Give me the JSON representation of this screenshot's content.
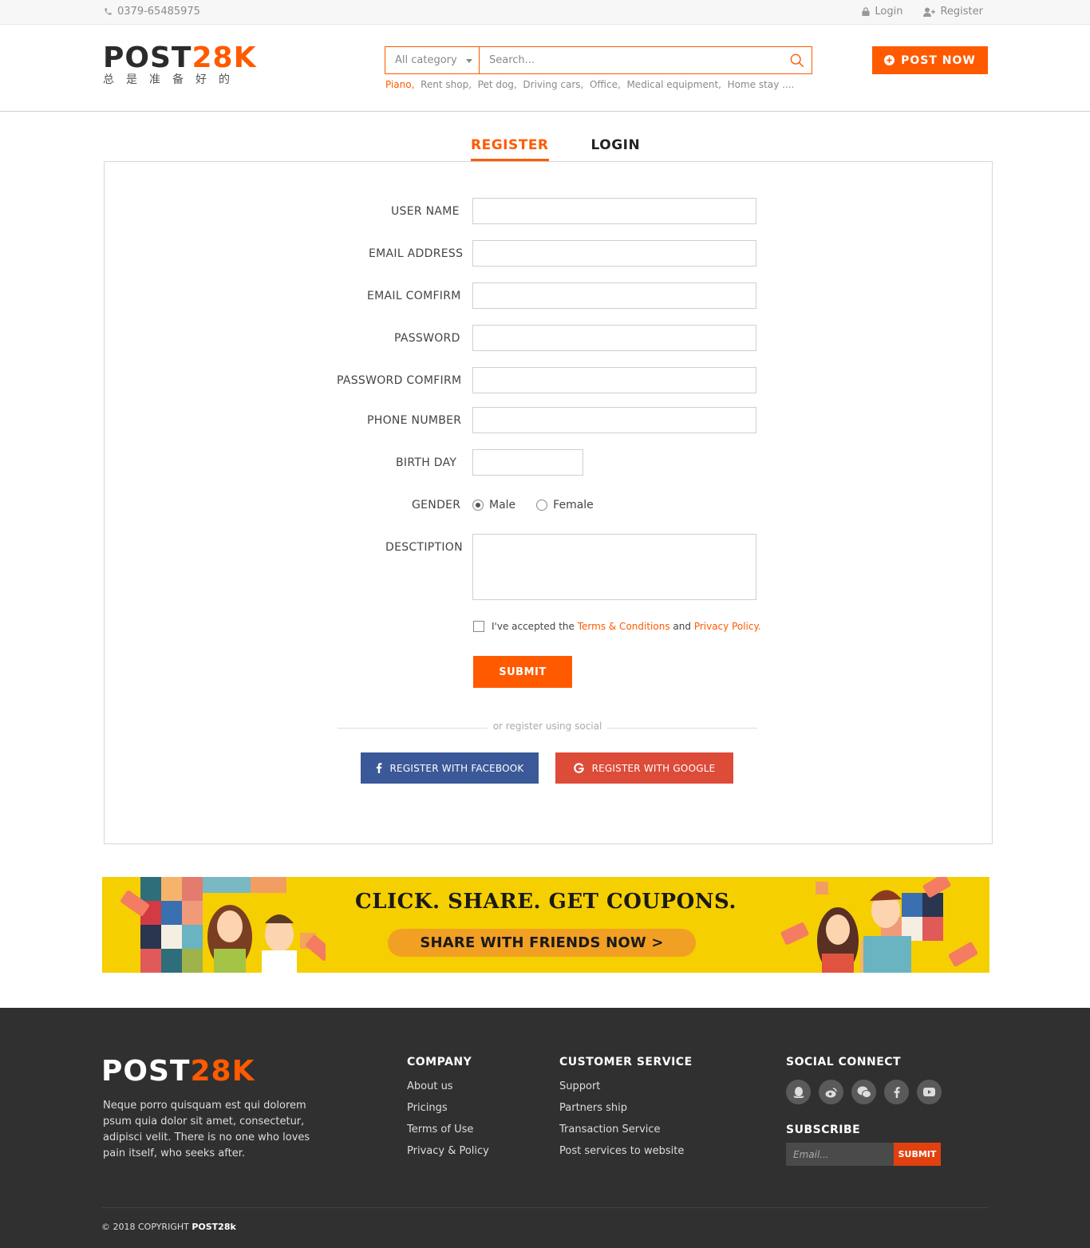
{
  "topbar": {
    "phone": "0379-65485975",
    "login": "Login",
    "register": "Register"
  },
  "brand": {
    "name_a": "POST",
    "name_b": "28K",
    "tagline": "总是准备好的",
    "accent": "#ff5a00"
  },
  "search": {
    "category": "All category",
    "placeholder": "Search...",
    "tags": [
      "Piano,",
      "Rent shop,",
      "Pet dog,",
      "Driving cars,",
      "Office,",
      "Medical equipment,",
      "Home stay ...."
    ]
  },
  "post_now": "POST NOW",
  "tabs": {
    "register": "REGISTER",
    "login": "LOGIN",
    "active": "register"
  },
  "form": {
    "username": "USER NAME",
    "email": "EMAIL ADDRESS",
    "email_confirm": "EMAIL COMFIRM",
    "password": "PASSWORD",
    "password_confirm": "PASSWORD COMFIRM",
    "phone": "PHONE NUMBER",
    "birthday": "BIRTH DAY",
    "gender": "GENDER",
    "gender_male": "Male",
    "gender_female": "Female",
    "gender_selected": "Male",
    "description": "DESCTIPTION",
    "terms_pre": "I've accepted the",
    "terms_link": "Terms & Conditions",
    "terms_and": "and",
    "privacy_link": "Privacy Policy.",
    "submit": "SUBMIT",
    "social_divider": "or register using social",
    "facebook": "REGISTER WITH FACEBOOK",
    "google": "REGISTER WITH GOOGLE",
    "facebook_color": "#3b5998",
    "google_color": "#dd4b39"
  },
  "banner": {
    "headline": "CLICK. SHARE. GET COUPONS.",
    "cta": "SHARE WITH FRIENDS NOW  >",
    "background": "#f5cf00"
  },
  "footer": {
    "description": "Neque porro quisquam est qui dolorem psum quia dolor sit amet, consectetur, adipisci velit. There is no one who loves pain itself, who seeks after.",
    "company": {
      "title": "COMPANY",
      "items": [
        "About us",
        "Pricings",
        "Terms of Use",
        "Privacy & Policy"
      ]
    },
    "service": {
      "title": "CUSTOMER SERVICE",
      "items": [
        "Support",
        "Partners ship",
        "Transaction Service",
        "Post services to website"
      ]
    },
    "social": {
      "title": "SOCIAL CONNECT",
      "icons": [
        "qq-icon",
        "weibo-icon",
        "wechat-icon",
        "facebook-icon",
        "youtube-icon"
      ]
    },
    "subscribe": {
      "title": "SUBSCRIBE",
      "placeholder": "Email...",
      "button": "SUBMIT"
    },
    "copyright_pre": "© 2018 COPYRIGHT",
    "copyright_brand": "POST28k"
  }
}
